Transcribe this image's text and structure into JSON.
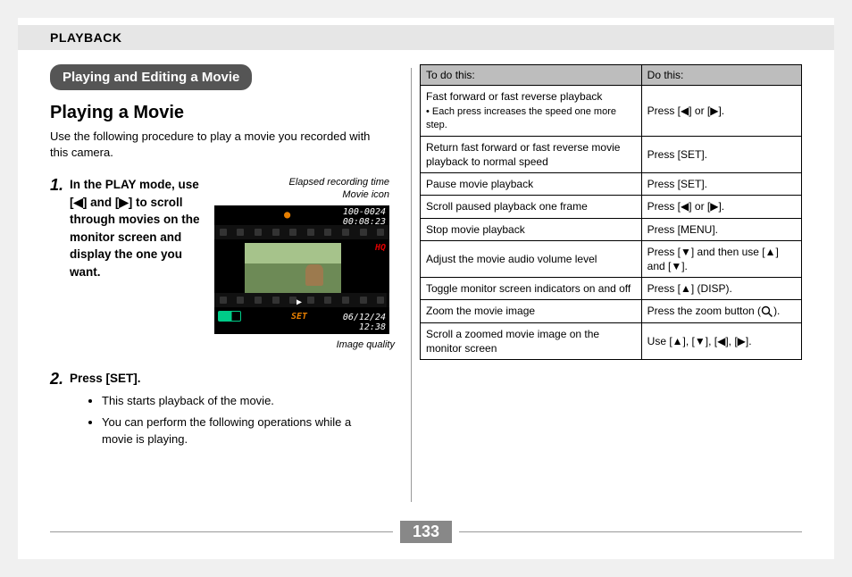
{
  "header": {
    "section": "PLAYBACK"
  },
  "left": {
    "pill": "Playing and Editing a Movie",
    "subtitle": "Playing a Movie",
    "intro": "Use the following procedure to play a movie you recorded with this camera.",
    "step1": {
      "num": "1.",
      "text": "In the PLAY mode, use [◀] and [▶] to scroll through movies on the monitor screen and display the one you want.",
      "caption_top_line1": "Elapsed recording time",
      "caption_top_line2": "Movie icon",
      "osd_file": "100-0024",
      "osd_time": "00:08:23",
      "osd_hq": "HQ",
      "osd_set": "SET",
      "osd_date": "06/12/24",
      "osd_clock": "12:38",
      "caption_bottom": "Image quality"
    },
    "step2": {
      "num": "2.",
      "text": "Press [SET].",
      "bullets": [
        "This starts playback of the movie.",
        "You can perform the following operations while a movie is playing."
      ]
    }
  },
  "table": {
    "head_left": "To do this:",
    "head_right": "Do this:",
    "rows": [
      {
        "left": "Fast forward or fast reverse playback",
        "left_sub": "• Each press increases the speed one more step.",
        "right": "Press [◀] or [▶]."
      },
      {
        "left": "Return fast forward or fast reverse movie playback to normal speed",
        "right": "Press [SET]."
      },
      {
        "left": "Pause movie playback",
        "right": "Press [SET]."
      },
      {
        "left": "Scroll paused playback one frame",
        "right": "Press [◀] or [▶]."
      },
      {
        "left": "Stop movie playback",
        "right": "Press [MENU]."
      },
      {
        "left": "Adjust the movie audio volume level",
        "right": "Press [▼] and then use [▲] and [▼]."
      },
      {
        "left": "Toggle monitor screen indicators on and off",
        "right": "Press [▲] (DISP)."
      },
      {
        "left": "Zoom the movie image",
        "right_prefix": "Press the zoom button (",
        "right_suffix": ")."
      },
      {
        "left": "Scroll a zoomed movie image on the monitor screen",
        "right": "Use [▲], [▼], [◀], [▶]."
      }
    ]
  },
  "footer": {
    "page": "133"
  }
}
